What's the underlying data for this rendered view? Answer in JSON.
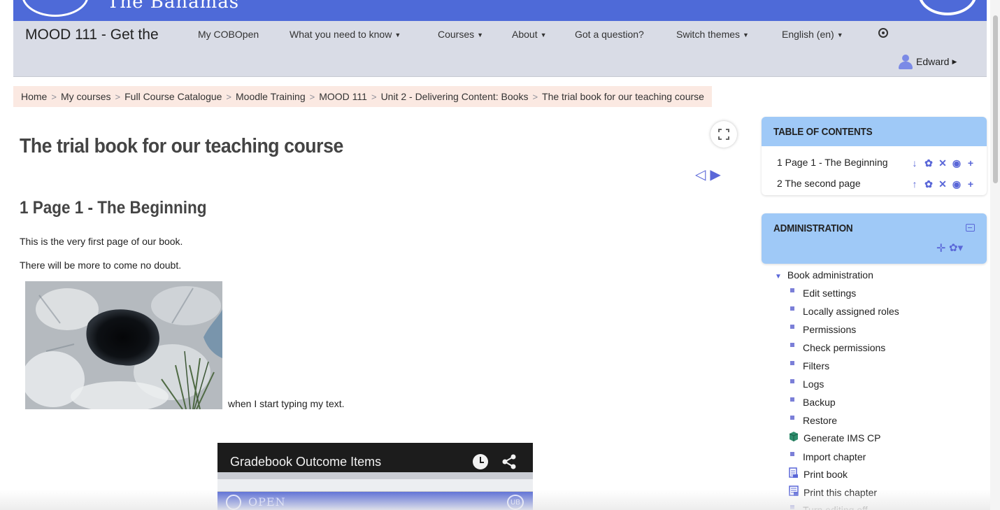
{
  "banner": {
    "site_name": "The Bahamas"
  },
  "navbar": {
    "brand": "MOOD 111 - Get the",
    "items": [
      {
        "label": "My COBOpen",
        "dropdown": false
      },
      {
        "label": "What you need to know",
        "dropdown": true
      },
      {
        "label": "Courses",
        "dropdown": true
      },
      {
        "label": "About",
        "dropdown": true
      },
      {
        "label": "Got a question?",
        "dropdown": false
      },
      {
        "label": "Switch themes",
        "dropdown": true
      },
      {
        "label": "English (en)",
        "dropdown": true
      }
    ],
    "user": "Edward"
  },
  "breadcrumb": [
    "Home",
    "My courses",
    "Full Course Catalogue",
    "Moodle Training",
    "MOOD 111",
    "Unit 2 - Delivering Content: Books",
    "The trial book for our teaching course"
  ],
  "main": {
    "title": "The trial book for our teaching course",
    "chapter_title": "1 Page 1 - The Beginning",
    "paragraph1": "This is the very first page of our book.",
    "paragraph2": "There will be more to come no doubt.",
    "after_image_text": "when I start typing my text.",
    "video": {
      "title": "Gradebook Outcome Items",
      "inner_text": "OPEN",
      "inner_badge": "UB"
    }
  },
  "toc": {
    "header": "TABLE OF CONTENTS",
    "items": [
      {
        "label": "1 Page 1 - The Beginning",
        "move": "↓"
      },
      {
        "label": "2 The second page",
        "move": "↑"
      }
    ]
  },
  "admin": {
    "header": "ADMINISTRATION",
    "root": "Book administration",
    "items": [
      {
        "label": "Edit settings",
        "icon": "bullet"
      },
      {
        "label": "Locally assigned roles",
        "icon": "bullet"
      },
      {
        "label": "Permissions",
        "icon": "bullet"
      },
      {
        "label": "Check permissions",
        "icon": "bullet"
      },
      {
        "label": "Filters",
        "icon": "bullet"
      },
      {
        "label": "Logs",
        "icon": "bullet"
      },
      {
        "label": "Backup",
        "icon": "bullet"
      },
      {
        "label": "Restore",
        "icon": "bullet"
      },
      {
        "label": "Generate IMS CP",
        "icon": "package-icon"
      },
      {
        "label": "Import chapter",
        "icon": "bullet"
      },
      {
        "label": "Print book",
        "icon": "print-book-icon"
      },
      {
        "label": "Print this chapter",
        "icon": "print-chapter-icon"
      },
      {
        "label": "Turn editing off",
        "icon": "bullet"
      }
    ]
  },
  "colors": {
    "brand_blue": "#4e6ad8",
    "block_header": "#9fc9f7",
    "accent": "#5a67d8",
    "breadcrumb_bg": "#fbe9e2"
  }
}
